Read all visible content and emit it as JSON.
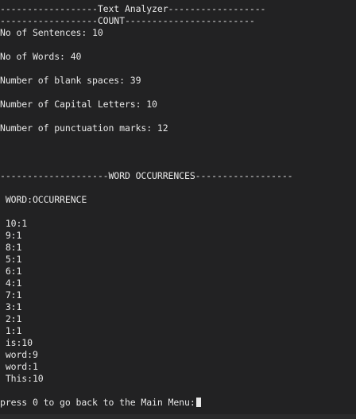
{
  "header": {
    "title_rule": "------------------Text Analyzer------------------",
    "count_rule": "------------------COUNT------------------------"
  },
  "counts": {
    "sentences": "No of Sentences: 10",
    "words": "No of Words: 40",
    "blank_spaces": "Number of blank spaces: 39",
    "capital_letters": "Number of Capital Letters: 10",
    "punctuation": "Number of punctuation marks: 12"
  },
  "occurrences": {
    "rule": "--------------------WORD OCCURRENCES------------------",
    "header": " WORD:OCCURRENCE",
    "items": [
      " 10:1",
      " 9:1",
      " 8:1",
      " 5:1",
      " 6:1",
      " 4:1",
      " 7:1",
      " 3:1",
      " 2:1",
      " 1:1",
      " is:10",
      " word:9",
      " word:1",
      " This:10"
    ]
  },
  "prompt": {
    "text": "press 0 to go back to the Main Menu:"
  }
}
